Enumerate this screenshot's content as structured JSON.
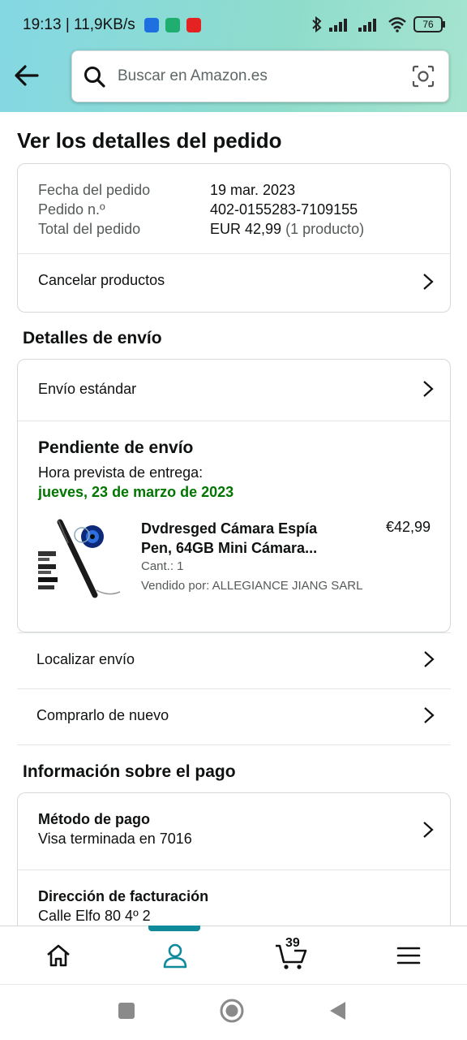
{
  "status_bar": {
    "time": "19:13 | 11,9KB/s",
    "battery": "76"
  },
  "search": {
    "placeholder": "Buscar en Amazon.es"
  },
  "page_title": "Ver los detalles del pedido",
  "order_summary": {
    "date_label": "Fecha del pedido",
    "date_value": "19 mar. 2023",
    "number_label": "Pedido n.º",
    "number_value": "402-0155283-7109155",
    "total_label": "Total del pedido",
    "total_value": "EUR 42,99",
    "total_count": "(1 producto)",
    "cancel_label": "Cancelar productos"
  },
  "shipping": {
    "section_title": "Detalles de envío",
    "method": "Envío estándar",
    "status": "Pendiente de envío",
    "eta_label": "Hora prevista de entrega:",
    "eta_date": "jueves, 23 de marzo de 2023",
    "product": {
      "title_line1": "Dvdresged Cámara Espía",
      "title_line2": "Pen, 64GB Mini Cámara...",
      "price": "€42,99",
      "qty": "Cant.: 1",
      "seller": "Vendido por: ALLEGIANCE JIANG SARL"
    },
    "track": "Localizar envío",
    "buy_again": "Comprarlo de nuevo"
  },
  "payment": {
    "section_title": "Información sobre el pago",
    "method_label": "Método de pago",
    "method_value": "Visa terminada en 7016",
    "billing_label": "Dirección de facturación",
    "billing_value": "Calle Elfo 80 4º 2"
  },
  "bottom_nav": {
    "cart_count": "39"
  },
  "colors": {
    "accent": "#0f8a9a",
    "eta_green": "#007600",
    "header_start": "#84d8e3",
    "header_end": "#a6e4cf"
  }
}
